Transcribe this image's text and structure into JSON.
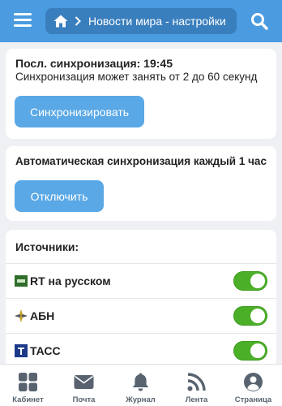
{
  "header": {
    "breadcrumb_label": "Новости мира - настройки"
  },
  "sync": {
    "title": "Посл. синхронизация: 19:45",
    "description": "Синхронизация может занять от 2 до 60 секунд",
    "button_label": "Синхронизировать"
  },
  "auto_sync": {
    "title": "Автоматическая синхронизация каждый 1 час",
    "button_label": "Отключить"
  },
  "sources": {
    "title": "Источники:",
    "items": [
      {
        "name": "RT на русском",
        "icon": "rt-logo-icon",
        "enabled": true
      },
      {
        "name": "АБН",
        "icon": "abn-logo-icon",
        "enabled": true
      },
      {
        "name": "ТАСС",
        "icon": "tass-logo-icon",
        "enabled": true
      }
    ]
  },
  "bottom_nav": {
    "items": [
      {
        "label": "Кабинет",
        "icon": "grid-icon"
      },
      {
        "label": "Почта",
        "icon": "envelope-icon"
      },
      {
        "label": "Журнал",
        "icon": "bell-icon"
      },
      {
        "label": "Лента",
        "icon": "rss-icon"
      },
      {
        "label": "Страница",
        "icon": "user-icon"
      }
    ]
  },
  "colors": {
    "primary": "#4a9be0",
    "button": "#5aa8e6",
    "toggle_on": "#4caf28",
    "nav_text": "#58636f"
  }
}
